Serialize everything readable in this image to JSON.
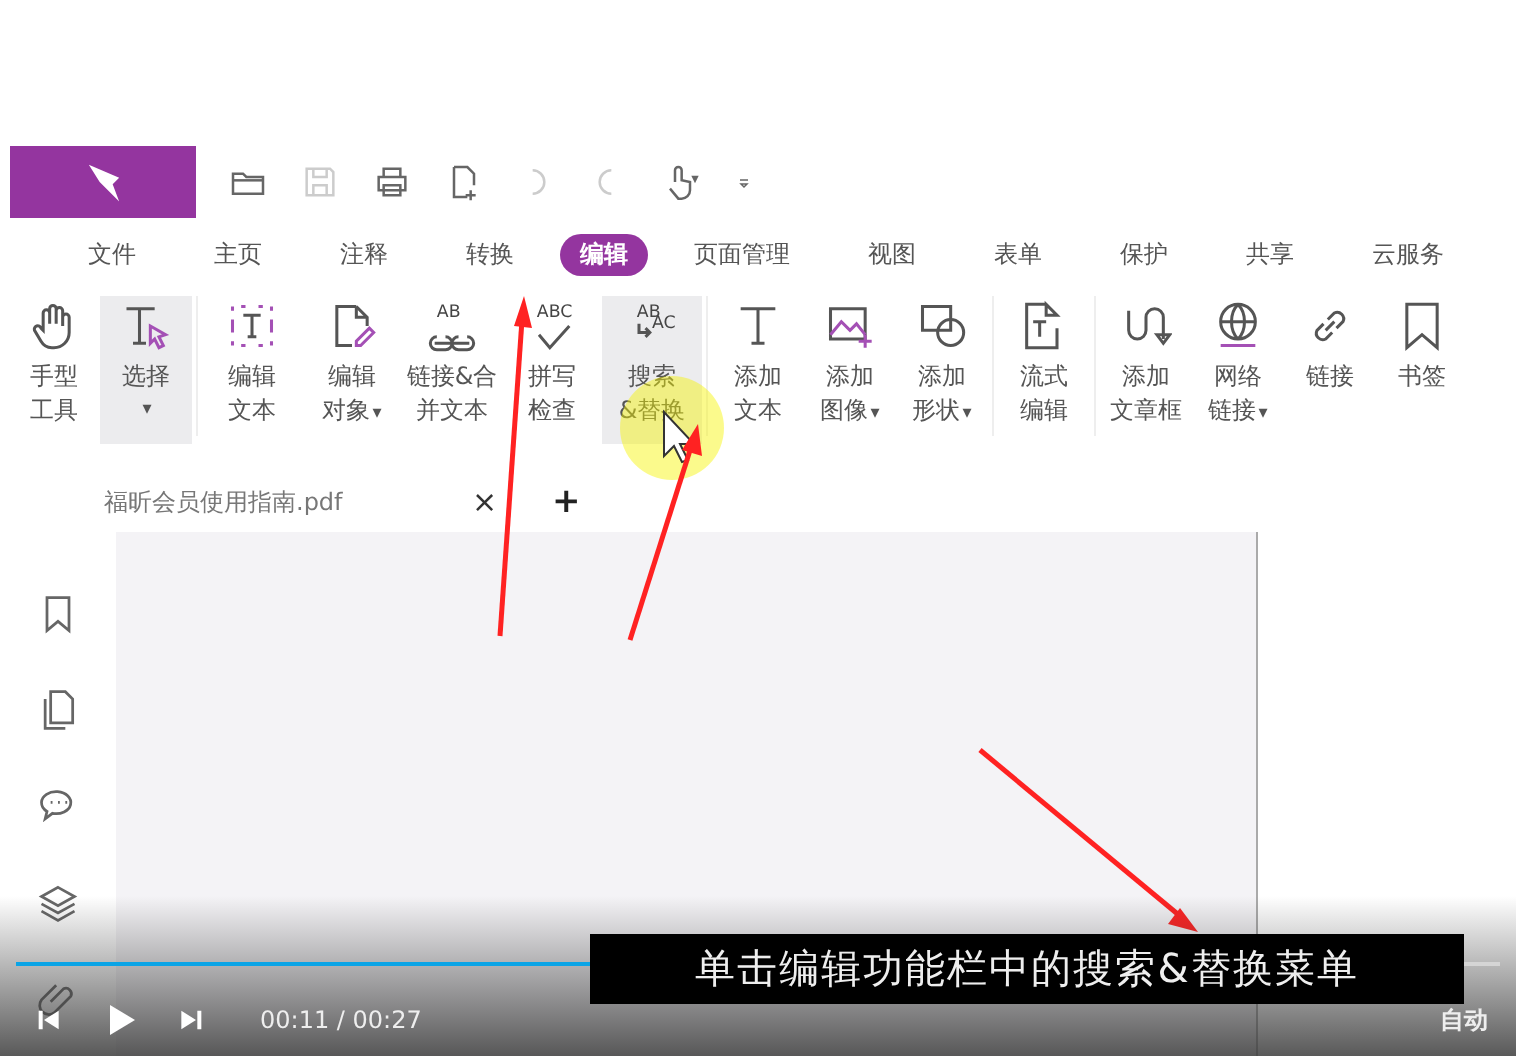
{
  "app": {
    "quick_access": [
      {
        "kind": "folder",
        "disabled": false
      },
      {
        "kind": "save",
        "disabled": true
      },
      {
        "kind": "print",
        "disabled": false
      },
      {
        "kind": "new-page",
        "disabled": false
      },
      {
        "kind": "undo",
        "disabled": true
      },
      {
        "kind": "redo",
        "disabled": true
      },
      {
        "kind": "touch",
        "disabled": false
      },
      {
        "kind": "customize",
        "disabled": false
      }
    ],
    "tabs": [
      {
        "label": "文件",
        "selected": false
      },
      {
        "label": "主页",
        "selected": false
      },
      {
        "label": "注释",
        "selected": false
      },
      {
        "label": "转换",
        "selected": false
      },
      {
        "label": "编辑",
        "selected": true
      },
      {
        "label": "页面管理",
        "selected": false
      },
      {
        "label": "视图",
        "selected": false
      },
      {
        "label": "表单",
        "selected": false
      },
      {
        "label": "保护",
        "selected": false
      },
      {
        "label": "共享",
        "selected": false
      },
      {
        "label": "云服务",
        "selected": false
      }
    ],
    "ribbon_groups": [
      {
        "items": [
          {
            "kind": "hand",
            "lines": [
              "手型",
              "工具"
            ],
            "selected": false
          },
          {
            "kind": "select",
            "lines": [
              "选择"
            ],
            "caret": "▾",
            "selected": true
          }
        ]
      },
      {
        "items": [
          {
            "kind": "edit-text",
            "lines": [
              "编辑",
              "文本"
            ],
            "selected": false
          },
          {
            "kind": "edit-object",
            "lines": [
              "编辑",
              "对象"
            ],
            "caret": "▾",
            "selected": false
          },
          {
            "kind": "link-merge",
            "icon_text": [
              "AB"
            ],
            "lines": [
              "链接&合",
              "并文本"
            ],
            "selected": false
          },
          {
            "kind": "spell",
            "icon_text": [
              "ABC"
            ],
            "lines": [
              "拼写",
              "检查"
            ],
            "selected": false
          },
          {
            "kind": "replace",
            "icon_text": [
              "AB",
              "AC"
            ],
            "lines": [
              "搜索",
              "&替换"
            ],
            "selected": true
          }
        ]
      },
      {
        "items": [
          {
            "kind": "add-text",
            "lines": [
              "添加",
              "文本"
            ],
            "selected": false
          },
          {
            "kind": "add-image",
            "lines": [
              "添加",
              "图像"
            ],
            "caret": "▾",
            "selected": false
          },
          {
            "kind": "add-shape",
            "lines": [
              "添加",
              "形状"
            ],
            "caret": "▾",
            "selected": false
          }
        ]
      },
      {
        "items": [
          {
            "kind": "flow-edit",
            "lines": [
              "流式",
              "编辑"
            ],
            "selected": false
          }
        ]
      },
      {
        "items": [
          {
            "kind": "article",
            "lines": [
              "添加",
              "文章框"
            ],
            "selected": false
          },
          {
            "kind": "web-link",
            "lines": [
              "网络",
              "链接"
            ],
            "caret": "▾",
            "selected": false
          },
          {
            "kind": "link",
            "lines": [
              "链接"
            ],
            "selected": false
          },
          {
            "kind": "bookmark",
            "lines": [
              "书签"
            ],
            "selected": false
          }
        ]
      }
    ],
    "document_tab": {
      "title": "福昕会员使用指南.pdf",
      "close": "×",
      "new": "+"
    }
  },
  "video": {
    "subtitle": "单击编辑功能栏中的搜索&替换菜单",
    "level": 0.55,
    "time": "00:11 / 00:27",
    "quality": "自动"
  }
}
